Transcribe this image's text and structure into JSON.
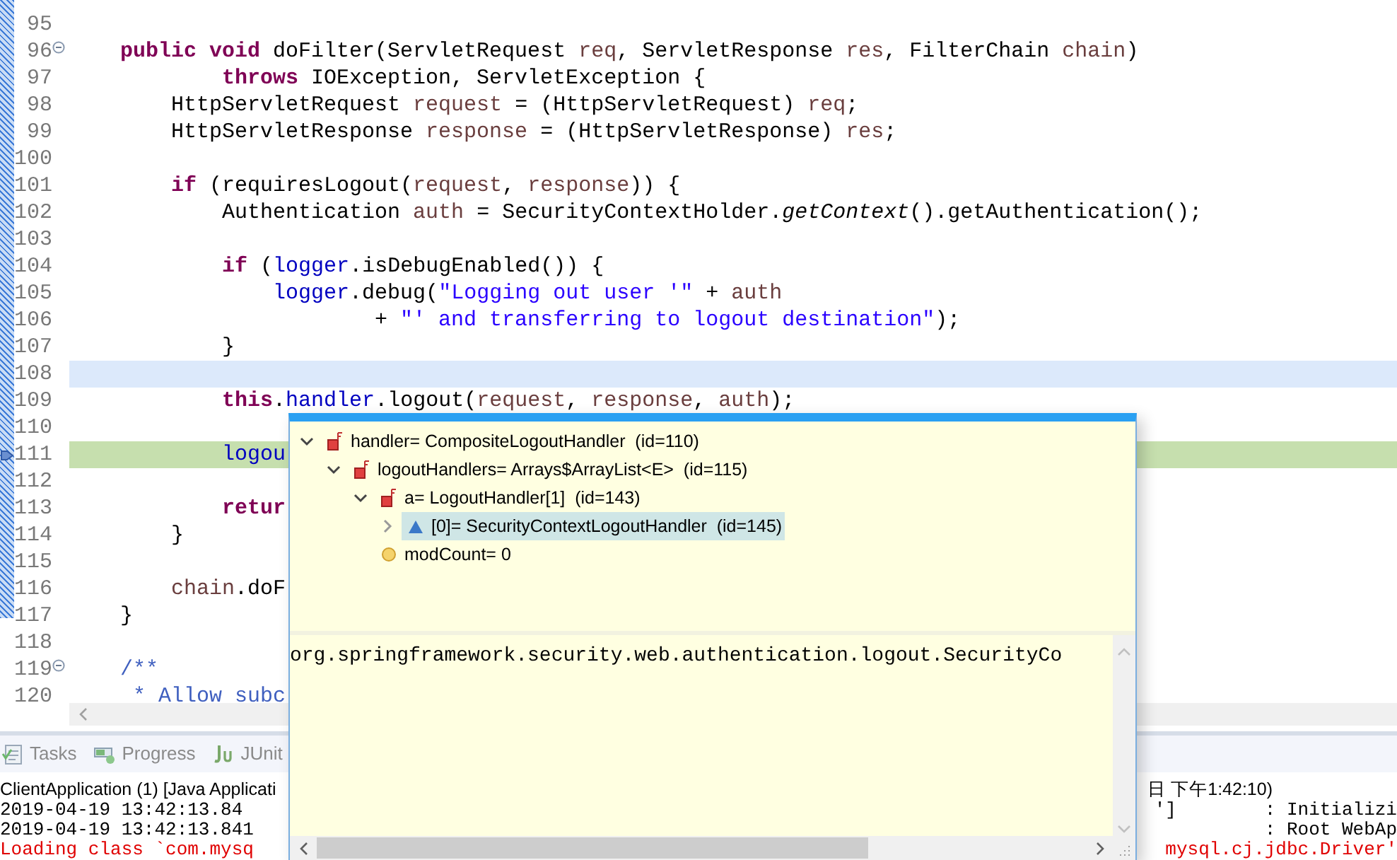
{
  "editor": {
    "lines": [
      {
        "number": "95",
        "cursor_line": false,
        "current_line": false
      },
      {
        "number": "96",
        "fold": true,
        "cursor_line": false,
        "current_line": false,
        "tokens": [
          {
            "kind": "keyword",
            "text": "    public"
          },
          {
            "kind": "keyword",
            "text": " void"
          },
          {
            "kind": "plain",
            "text": " doFilter(ServletRequest "
          },
          {
            "kind": "variable",
            "text": "req"
          },
          {
            "kind": "plain",
            "text": ", ServletResponse "
          },
          {
            "kind": "variable",
            "text": "res"
          },
          {
            "kind": "plain",
            "text": ", FilterChain "
          },
          {
            "kind": "variable",
            "text": "chain"
          },
          {
            "kind": "plain",
            "text": ")"
          }
        ]
      },
      {
        "number": "97",
        "cursor_line": false,
        "current_line": false,
        "tokens": [
          {
            "kind": "keyword",
            "text": "            throws"
          },
          {
            "kind": "plain",
            "text": " IOException, ServletException {"
          }
        ]
      },
      {
        "number": "98",
        "cursor_line": false,
        "current_line": false,
        "tokens": [
          {
            "kind": "plain",
            "text": "        HttpServletRequest "
          },
          {
            "kind": "variable",
            "text": "request"
          },
          {
            "kind": "plain",
            "text": " = (HttpServletRequest) "
          },
          {
            "kind": "variable",
            "text": "req"
          },
          {
            "kind": "plain",
            "text": ";"
          }
        ]
      },
      {
        "number": "99",
        "cursor_line": false,
        "current_line": false,
        "tokens": [
          {
            "kind": "plain",
            "text": "        HttpServletResponse "
          },
          {
            "kind": "variable",
            "text": "response"
          },
          {
            "kind": "plain",
            "text": " = (HttpServletResponse) "
          },
          {
            "kind": "variable",
            "text": "res"
          },
          {
            "kind": "plain",
            "text": ";"
          }
        ]
      },
      {
        "number": "100",
        "cursor_line": false,
        "current_line": false
      },
      {
        "number": "101",
        "cursor_line": false,
        "current_line": false,
        "tokens": [
          {
            "kind": "keyword",
            "text": "        if"
          },
          {
            "kind": "plain",
            "text": " (requiresLogout("
          },
          {
            "kind": "variable",
            "text": "request"
          },
          {
            "kind": "plain",
            "text": ", "
          },
          {
            "kind": "variable",
            "text": "response"
          },
          {
            "kind": "plain",
            "text": ")) {"
          }
        ]
      },
      {
        "number": "102",
        "cursor_line": false,
        "current_line": false,
        "tokens": [
          {
            "kind": "plain",
            "text": "            Authentication "
          },
          {
            "kind": "variable",
            "text": "auth"
          },
          {
            "kind": "plain",
            "text": " = SecurityContextHolder."
          },
          {
            "kind": "static",
            "text": "getContext"
          },
          {
            "kind": "plain",
            "text": "().getAuthentication();"
          }
        ]
      },
      {
        "number": "103",
        "cursor_line": false,
        "current_line": false
      },
      {
        "number": "104",
        "cursor_line": false,
        "current_line": false,
        "tokens": [
          {
            "kind": "keyword",
            "text": "            if"
          },
          {
            "kind": "plain",
            "text": " ("
          },
          {
            "kind": "field",
            "text": "logger"
          },
          {
            "kind": "plain",
            "text": ".isDebugEnabled()) {"
          }
        ]
      },
      {
        "number": "105",
        "cursor_line": false,
        "current_line": false,
        "tokens": [
          {
            "kind": "field",
            "text": "                logger"
          },
          {
            "kind": "plain",
            "text": ".debug("
          },
          {
            "kind": "string",
            "text": "\"Logging out user '\""
          },
          {
            "kind": "plain",
            "text": " + "
          },
          {
            "kind": "variable",
            "text": "auth"
          }
        ]
      },
      {
        "number": "106",
        "cursor_line": false,
        "current_line": false,
        "tokens": [
          {
            "kind": "plain",
            "text": "                        + "
          },
          {
            "kind": "string",
            "text": "\"' and transferring to logout destination\""
          },
          {
            "kind": "plain",
            "text": ");"
          }
        ]
      },
      {
        "number": "107",
        "cursor_line": false,
        "current_line": false,
        "tokens": [
          {
            "kind": "plain",
            "text": "            }"
          }
        ]
      },
      {
        "number": "108",
        "cursor_line": true,
        "current_line": false
      },
      {
        "number": "109",
        "cursor_line": false,
        "current_line": false,
        "tokens": [
          {
            "kind": "keyword",
            "text": "            this"
          },
          {
            "kind": "plain",
            "text": "."
          },
          {
            "kind": "field",
            "text": "handler"
          },
          {
            "kind": "plain",
            "text": ".logout("
          },
          {
            "kind": "variable",
            "text": "request"
          },
          {
            "kind": "plain",
            "text": ", "
          },
          {
            "kind": "variable",
            "text": "response"
          },
          {
            "kind": "plain",
            "text": ", "
          },
          {
            "kind": "variable",
            "text": "auth"
          },
          {
            "kind": "plain",
            "text": ");"
          }
        ]
      },
      {
        "number": "110",
        "cursor_line": false,
        "current_line": false
      },
      {
        "number": "111",
        "cursor_line": false,
        "current_line": true,
        "tokens": [
          {
            "kind": "field",
            "text": "            logou"
          }
        ]
      },
      {
        "number": "112",
        "cursor_line": false,
        "current_line": false
      },
      {
        "number": "113",
        "cursor_line": false,
        "current_line": false,
        "tokens": [
          {
            "kind": "keyword",
            "text": "            retur"
          }
        ]
      },
      {
        "number": "114",
        "cursor_line": false,
        "current_line": false,
        "tokens": [
          {
            "kind": "plain",
            "text": "        }"
          }
        ]
      },
      {
        "number": "115",
        "cursor_line": false,
        "current_line": false
      },
      {
        "number": "116",
        "cursor_line": false,
        "current_line": false,
        "tokens": [
          {
            "kind": "variable",
            "text": "        chain"
          },
          {
            "kind": "plain",
            "text": ".doF"
          }
        ]
      },
      {
        "number": "117",
        "cursor_line": false,
        "current_line": false,
        "tokens": [
          {
            "kind": "plain",
            "text": "    }"
          }
        ]
      },
      {
        "number": "118",
        "cursor_line": false,
        "current_line": false
      },
      {
        "number": "119",
        "fold": true,
        "cursor_line": false,
        "current_line": false,
        "tokens": [
          {
            "kind": "javadoc",
            "text": "    /**"
          }
        ]
      },
      {
        "number": "120",
        "cursor_line": false,
        "current_line": false,
        "tokens": [
          {
            "kind": "javadoc",
            "text": "     * Allow subc"
          }
        ]
      }
    ]
  },
  "bottom_tabs": [
    {
      "label": "Tasks",
      "kind": "tasks"
    },
    {
      "label": "Progress",
      "kind": "progress"
    },
    {
      "label": "JUnit",
      "kind": "junit"
    }
  ],
  "console": {
    "title": "ClientApplication (1) [Java Applicati",
    "title_end": "日 下午1:42:10)",
    "lines": [
      {
        "left": "2019-04-19 13:42:13.84",
        "right": "']        : Initializi",
        "kind": "info"
      },
      {
        "left": "2019-04-19 13:42:13.841",
        "right": ": Root WebAp",
        "kind": "info"
      },
      {
        "left": "Loading class `com.mysq",
        "right": "mysql.cj.jdbc.Driver'",
        "kind": "error"
      }
    ]
  },
  "inspect_popup": {
    "tree": [
      {
        "label": "handler= CompositeLogoutHandler  (id=110)",
        "kind": "final_field",
        "expanded": true,
        "selected": false,
        "children": [
          {
            "label": "logoutHandlers= Arrays$ArrayList<E>  (id=115)",
            "kind": "final_field",
            "expanded": true,
            "selected": false,
            "children": [
              {
                "label": "a= LogoutHandler[1]  (id=143)",
                "kind": "final_field",
                "expanded": true,
                "selected": false,
                "children": [
                  {
                    "label": "[0]= SecurityContextLogoutHandler  (id=145)",
                    "kind": "protected_field",
                    "expanded": false,
                    "selected": true
                  }
                ]
              },
              {
                "label": "modCount= 0",
                "kind": "default_field",
                "selected": false
              }
            ]
          }
        ]
      }
    ],
    "detail": "org.springframework.security.web.authentication.logout.SecurityCo"
  }
}
